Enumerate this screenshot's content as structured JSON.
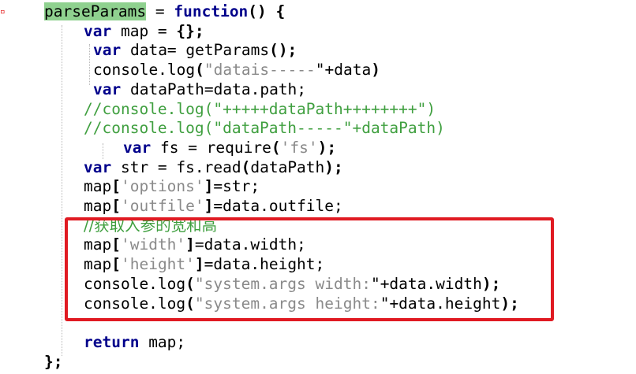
{
  "editor": {
    "gutter_marker": "▫",
    "lines": [
      {
        "parts": [
          {
            "t": "parseParams",
            "c": "hl"
          },
          {
            "t": " = "
          },
          {
            "t": "function",
            "c": "kw"
          },
          {
            "t": "() ",
            "c": "op"
          },
          {
            "t": "{",
            "c": "op"
          }
        ]
      },
      {
        "parts": [
          {
            "t": "var",
            "c": "kw"
          },
          {
            "t": " map = "
          },
          {
            "t": "{};",
            "c": "op"
          }
        ]
      },
      {
        "parts": [
          {
            "t": "var",
            "c": "kw"
          },
          {
            "t": " data= getParams"
          },
          {
            "t": "();",
            "c": "op"
          }
        ]
      },
      {
        "parts": [
          {
            "t": "console.log"
          },
          {
            "t": "(",
            "c": "op"
          },
          {
            "t": "\"datais-----",
            "c": "str"
          },
          {
            "t": "\"+data"
          },
          {
            "t": ")",
            "c": "op"
          }
        ]
      },
      {
        "parts": [
          {
            "t": "var",
            "c": "kw"
          },
          {
            "t": " dataPath=data.path;"
          }
        ]
      },
      {
        "parts": [
          {
            "t": "//console.log(\"+++++dataPath++++++++\")",
            "c": "cm"
          }
        ]
      },
      {
        "parts": [
          {
            "t": "//console.log(\"dataPath-----\"+dataPath)",
            "c": "cm"
          }
        ]
      },
      {
        "parts": [
          {
            "t": "var",
            "c": "kw"
          },
          {
            "t": " fs = require"
          },
          {
            "t": "(",
            "c": "op"
          },
          {
            "t": "'fs'",
            "c": "str"
          },
          {
            "t": ");",
            "c": "op"
          }
        ]
      },
      {
        "parts": [
          {
            "t": "var",
            "c": "kw"
          },
          {
            "t": " str = fs.read"
          },
          {
            "t": "(",
            "c": "op"
          },
          {
            "t": "dataPath"
          },
          {
            "t": ");",
            "c": "op"
          }
        ]
      },
      {
        "parts": [
          {
            "t": "map"
          },
          {
            "t": "[",
            "c": "op"
          },
          {
            "t": "'options'",
            "c": "str"
          },
          {
            "t": "]",
            "c": "op"
          },
          {
            "t": "=str;"
          }
        ]
      },
      {
        "parts": [
          {
            "t": "map"
          },
          {
            "t": "[",
            "c": "op"
          },
          {
            "t": "'outfile'",
            "c": "str"
          },
          {
            "t": "]",
            "c": "op"
          },
          {
            "t": "=data.outfile;"
          }
        ]
      },
      {
        "parts": [
          {
            "t": "//获取入参的宽和高",
            "c": "cm cjk"
          }
        ]
      },
      {
        "parts": [
          {
            "t": "map"
          },
          {
            "t": "[",
            "c": "op"
          },
          {
            "t": "'width'",
            "c": "str"
          },
          {
            "t": "]",
            "c": "op"
          },
          {
            "t": "=data.width;"
          }
        ]
      },
      {
        "parts": [
          {
            "t": "map"
          },
          {
            "t": "[",
            "c": "op"
          },
          {
            "t": "'height'",
            "c": "str"
          },
          {
            "t": "]",
            "c": "op"
          },
          {
            "t": "=data.height;"
          }
        ]
      },
      {
        "parts": [
          {
            "t": "console.log"
          },
          {
            "t": "(",
            "c": "op"
          },
          {
            "t": "\"system.args width:",
            "c": "str"
          },
          {
            "t": "\"+data.width"
          },
          {
            "t": ");",
            "c": "op"
          }
        ]
      },
      {
        "parts": [
          {
            "t": "console.log"
          },
          {
            "t": "(",
            "c": "op"
          },
          {
            "t": "\"system.args height:",
            "c": "str"
          },
          {
            "t": "\"+data.height"
          },
          {
            "t": ");",
            "c": "op"
          }
        ]
      },
      {
        "parts": []
      },
      {
        "parts": [
          {
            "t": "return",
            "c": "kw"
          },
          {
            "t": " map;"
          }
        ]
      },
      {
        "parts": [
          {
            "t": "};",
            "c": "op"
          }
        ]
      }
    ]
  },
  "colors": {
    "keyword": "#00008b",
    "string": "#8a8a8a",
    "comment": "#3f9f3f",
    "highlight": "#8fd18f",
    "annotation_box": "#e01a22"
  }
}
